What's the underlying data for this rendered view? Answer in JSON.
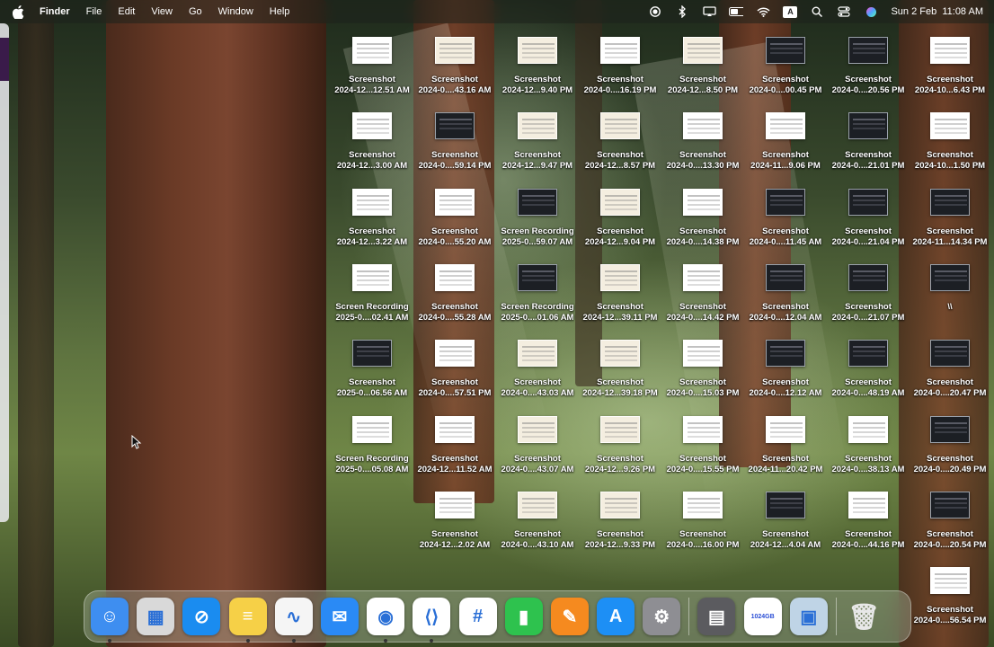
{
  "menubar": {
    "app_name": "Finder",
    "items": [
      "File",
      "Edit",
      "View",
      "Go",
      "Window",
      "Help"
    ],
    "input_source": "A",
    "datetime": "Sun 2 Feb  11:08 AM"
  },
  "desktop": {
    "columns": [
      [
        {
          "name": "Screenshot",
          "date": "2024-12...12.51 AM",
          "thumb": "white"
        },
        {
          "name": "Screenshot",
          "date": "2024-12...3.00 AM",
          "thumb": "white"
        },
        {
          "name": "Screenshot",
          "date": "2024-12...3.22 AM",
          "thumb": "white"
        },
        {
          "name": "Screen Recording",
          "date": "2025-0....02.41 AM",
          "thumb": "white"
        },
        {
          "name": "Screenshot",
          "date": "2025-0...06.56 AM",
          "thumb": "dark"
        },
        {
          "name": "Screen Recording",
          "date": "2025-0....05.08 AM",
          "thumb": "white"
        }
      ],
      [
        {
          "name": "Screenshot",
          "date": "2024-0....43.16 AM",
          "thumb": "beige"
        },
        {
          "name": "Screenshot",
          "date": "2024-0....59.14 PM",
          "thumb": "dark"
        },
        {
          "name": "Screenshot",
          "date": "2024-0....55.20 AM",
          "thumb": "white"
        },
        {
          "name": "Screenshot",
          "date": "2024-0....55.28 AM",
          "thumb": "white"
        },
        {
          "name": "Screenshot",
          "date": "2024-0....57.51 PM",
          "thumb": "white"
        },
        {
          "name": "Screenshot",
          "date": "2024-12...11.52 AM",
          "thumb": "white"
        },
        {
          "name": "Screenshot",
          "date": "2024-12...2.02 AM",
          "thumb": "white"
        }
      ],
      [
        {
          "name": "Screenshot",
          "date": "2024-12...9.40 PM",
          "thumb": "beige"
        },
        {
          "name": "Screenshot",
          "date": "2024-12...9.47 PM",
          "thumb": "beige"
        },
        {
          "name": "Screen Recording",
          "date": "2025-0...59.07 AM",
          "thumb": "dark"
        },
        {
          "name": "Screen Recording",
          "date": "2025-0....01.06 AM",
          "thumb": "dark"
        },
        {
          "name": "Screenshot",
          "date": "2024-0....43.03 AM",
          "thumb": "beige"
        },
        {
          "name": "Screenshot",
          "date": "2024-0....43.07 AM",
          "thumb": "beige"
        },
        {
          "name": "Screenshot",
          "date": "2024-0....43.10 AM",
          "thumb": "beige"
        }
      ],
      [
        {
          "name": "Screenshot",
          "date": "2024-0....16.19 PM",
          "thumb": "white"
        },
        {
          "name": "Screenshot",
          "date": "2024-12...8.57 PM",
          "thumb": "beige"
        },
        {
          "name": "Screenshot",
          "date": "2024-12...9.04 PM",
          "thumb": "beige"
        },
        {
          "name": "Screenshot",
          "date": "2024-12...39.11 PM",
          "thumb": "beige"
        },
        {
          "name": "Screenshot",
          "date": "2024-12...39.18 PM",
          "thumb": "beige"
        },
        {
          "name": "Screenshot",
          "date": "2024-12...9.26 PM",
          "thumb": "beige"
        },
        {
          "name": "Screenshot",
          "date": "2024-12...9.33 PM",
          "thumb": "beige"
        }
      ],
      [
        {
          "name": "Screenshot",
          "date": "2024-12...8.50 PM",
          "thumb": "beige"
        },
        {
          "name": "Screenshot",
          "date": "2024-0....13.30 PM",
          "thumb": "white"
        },
        {
          "name": "Screenshot",
          "date": "2024-0....14.38 PM",
          "thumb": "white"
        },
        {
          "name": "Screenshot",
          "date": "2024-0....14.42 PM",
          "thumb": "white"
        },
        {
          "name": "Screenshot",
          "date": "2024-0....15.03 PM",
          "thumb": "white"
        },
        {
          "name": "Screenshot",
          "date": "2024-0....15.55 PM",
          "thumb": "white"
        },
        {
          "name": "Screenshot",
          "date": "2024-0....16.00 PM",
          "thumb": "white"
        }
      ],
      [
        {
          "name": "Screenshot",
          "date": "2024-0....00.45 PM",
          "thumb": "dark"
        },
        {
          "name": "Screenshot",
          "date": "2024-11...9.06 PM",
          "thumb": "white"
        },
        {
          "name": "Screenshot",
          "date": "2024-0....11.45 AM",
          "thumb": "dark"
        },
        {
          "name": "Screenshot",
          "date": "2024-0....12.04 AM",
          "thumb": "dark"
        },
        {
          "name": "Screenshot",
          "date": "2024-0....12.12 AM",
          "thumb": "dark"
        },
        {
          "name": "Screenshot",
          "date": "2024-11...20.42 PM",
          "thumb": "white"
        },
        {
          "name": "Screenshot",
          "date": "2024-12...4.04 AM",
          "thumb": "dark"
        }
      ],
      [
        {
          "name": "Screenshot",
          "date": "2024-0....20.56 PM",
          "thumb": "dark"
        },
        {
          "name": "Screenshot",
          "date": "2024-0....21.01 PM",
          "thumb": "dark"
        },
        {
          "name": "Screenshot",
          "date": "2024-0....21.04 PM",
          "thumb": "dark"
        },
        {
          "name": "Screenshot",
          "date": "2024-0....21.07 PM",
          "thumb": "dark"
        },
        {
          "name": "Screenshot",
          "date": "2024-0....48.19 AM",
          "thumb": "dark"
        },
        {
          "name": "Screenshot",
          "date": "2024-0....38.13 AM",
          "thumb": "white"
        },
        {
          "name": "Screenshot",
          "date": "2024-0....44.16 PM",
          "thumb": "white"
        }
      ],
      [
        {
          "name": "Screenshot",
          "date": "2024-10...6.43 PM",
          "thumb": "white"
        },
        {
          "name": "Screenshot",
          "date": "2024-10...1.50 PM",
          "thumb": "white"
        },
        {
          "name": "Screenshot",
          "date": "2024-11...14.34 PM",
          "thumb": "dark"
        },
        {
          "name": "\\\\",
          "date": "",
          "thumb": "dark"
        },
        {
          "name": "Screenshot",
          "date": "2024-0....20.47 PM",
          "thumb": "dark"
        },
        {
          "name": "Screenshot",
          "date": "2024-0....20.49 PM",
          "thumb": "dark"
        },
        {
          "name": "Screenshot",
          "date": "2024-0....20.54 PM",
          "thumb": "dark"
        },
        {
          "name": "Screenshot",
          "date": "2024-0....56.54 PM",
          "thumb": "white"
        }
      ]
    ]
  },
  "dock": {
    "apps": [
      {
        "name": "finder-app-icon",
        "bg": "#3e8ef0",
        "glyph": "☺",
        "running": true
      },
      {
        "name": "launchpad-app-icon",
        "bg": "#d9d9d9",
        "glyph": "▦",
        "running": false
      },
      {
        "name": "safari-app-icon",
        "bg": "#1a8cf0",
        "glyph": "⊘",
        "running": false
      },
      {
        "name": "notes-app-icon",
        "bg": "#f6d047",
        "glyph": "≡",
        "running": true
      },
      {
        "name": "freeform-app-icon",
        "bg": "#f5f5f5",
        "glyph": "∿",
        "running": true
      },
      {
        "name": "mail-app-icon",
        "bg": "#2a8af5",
        "glyph": "✉",
        "running": false
      },
      {
        "name": "chrome-app-icon",
        "bg": "#ffffff",
        "glyph": "◉",
        "running": true
      },
      {
        "name": "vscode-app-icon",
        "bg": "#ffffff",
        "glyph": "⟨⟩",
        "running": true
      },
      {
        "name": "slack-app-icon",
        "bg": "#ffffff",
        "glyph": "#",
        "running": false
      },
      {
        "name": "numbers-app-icon",
        "bg": "#2ec24e",
        "glyph": "▮",
        "running": false
      },
      {
        "name": "pages-app-icon",
        "bg": "#f58a1f",
        "glyph": "✎",
        "running": false
      },
      {
        "name": "app-store-app-icon",
        "bg": "#1d8ff5",
        "glyph": "A",
        "running": false
      },
      {
        "name": "system-settings-app-icon",
        "bg": "#8e8e93",
        "glyph": "⚙",
        "running": false
      }
    ],
    "others": [
      {
        "name": "calculator-app-icon",
        "bg": "#5b5b5f",
        "glyph": "▤",
        "running": false
      },
      {
        "name": "storage-app-icon",
        "bg": "#ffffff",
        "glyph": "1024GB",
        "running": false
      },
      {
        "name": "preview-app-icon",
        "bg": "#bfd4e6",
        "glyph": "▣",
        "running": false
      }
    ],
    "trash": {
      "name": "trash-icon",
      "glyph": "🗑"
    }
  }
}
